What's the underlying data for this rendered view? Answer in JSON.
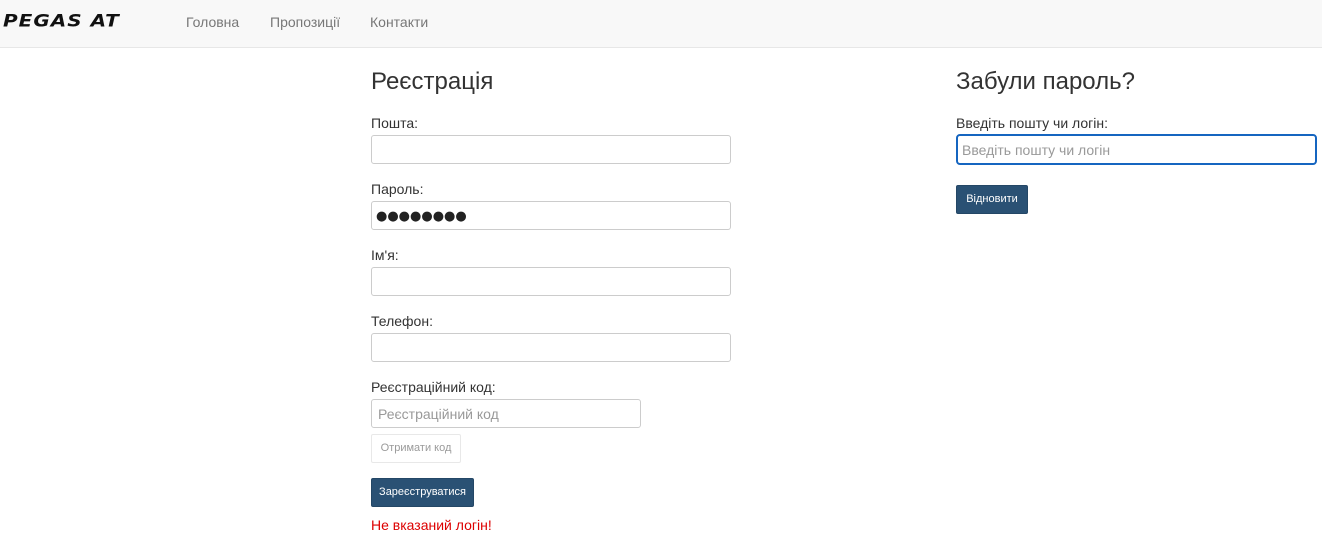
{
  "navbar": {
    "brand": "PEGAS AT",
    "links": [
      "Головна",
      "Пропозиції",
      "Контакти"
    ]
  },
  "registration": {
    "title": "Реєстрація",
    "email_label": "Пошта:",
    "email_value": "",
    "password_label": "Пароль:",
    "password_value": "●●●●●●●●",
    "name_label": "Ім'я:",
    "name_value": "",
    "phone_label": "Телефон:",
    "phone_value": "",
    "code_label": "Реєстраційний код:",
    "code_placeholder": "Реєстраційний код",
    "get_code_button": "Отримати код",
    "submit_button": "Зареєструватися",
    "error_message": "Не вказаний логін!"
  },
  "forgot": {
    "title": "Забули пароль?",
    "login_label": "Введіть пошту чи логін:",
    "login_placeholder": "Введіть пошту чи логін",
    "restore_button": "Відновити"
  },
  "colors": {
    "primary_button": "#2a5174",
    "error": "#dd0000",
    "focus_border": "#1565c0",
    "navbar_bg": "#f8f8f8"
  }
}
